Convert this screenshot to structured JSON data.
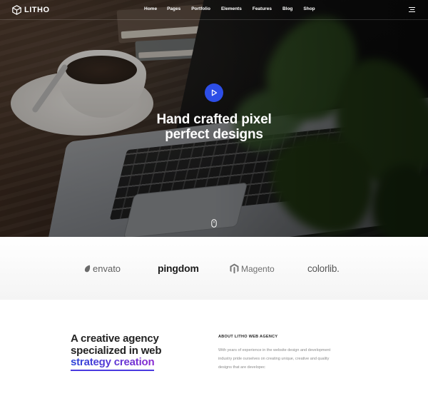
{
  "header": {
    "logo_text": "LITHO",
    "nav": [
      "Home",
      "Pages",
      "Portfolio",
      "Elements",
      "Features",
      "Blog",
      "Shop"
    ]
  },
  "hero": {
    "headline_line1": "Hand crafted pixel",
    "headline_line2": "perfect designs"
  },
  "clients": {
    "envato": "envato",
    "pingdom": "pingdom",
    "magento": "Magento",
    "colorlib": "colorlib."
  },
  "about": {
    "heading_line1": "A creative agency",
    "heading_line2": "specialized in web",
    "heading_highlight": "strategy creation",
    "label": "ABOUT LITHO WEB AGENCY",
    "text": "With years of experience in the website design and development industry pride ourselves on creating unique, creative and quality designs that are developec"
  },
  "colors": {
    "accent": "#2d4ee7",
    "gradient_start": "#2b44d9",
    "gradient_end": "#8a2bd1",
    "heading": "#232323",
    "body_text": "#8b8b8b"
  },
  "icons": {
    "logo": "hexagon-cube-icon",
    "menu": "hamburger-icon",
    "play": "play-icon",
    "scroll": "mouse-icon"
  }
}
